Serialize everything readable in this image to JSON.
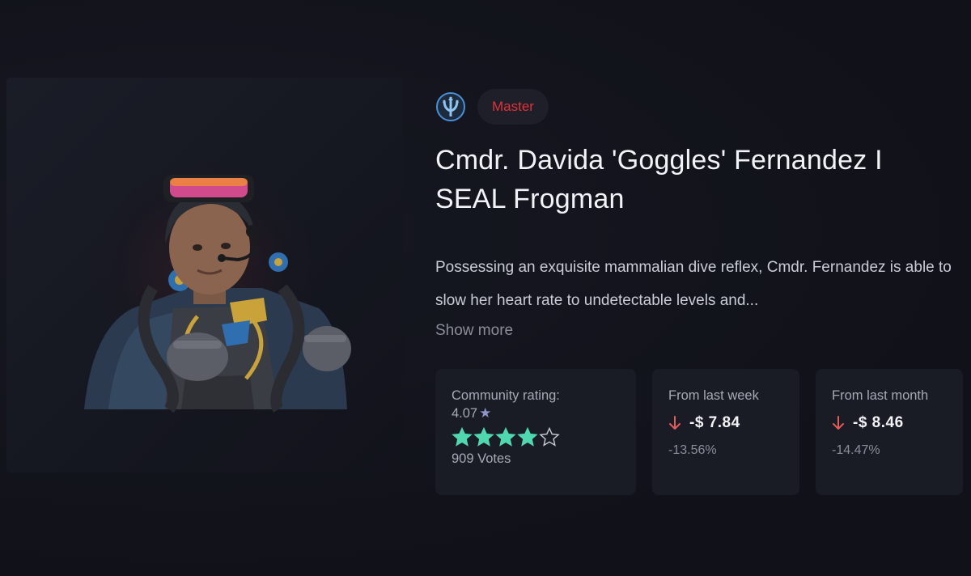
{
  "item": {
    "rarity": "Master",
    "title": "Cmdr. Davida 'Goggles' Fernandez I SEAL Frogman",
    "description": "Possessing an exquisite mammalian dive reflex, Cmdr. Fernandez is able to slow her heart rate to undetectable levels and...",
    "show_more_label": "Show more",
    "image_icon": "operator-portrait-image",
    "faction_icon": "trident-emblem-icon"
  },
  "rating": {
    "label": "Community rating:",
    "value": "4.07",
    "star_glyph": "★",
    "stars_value": 4.07,
    "stars_max": 5,
    "votes": "909 Votes"
  },
  "week": {
    "label": "From last week",
    "amount": "-$ 7.84",
    "percent": "-13.56%",
    "direction_icon": "arrow-down-icon"
  },
  "month": {
    "label": "From last month",
    "amount": "-$ 8.46",
    "percent": "-14.47%",
    "direction_icon": "arrow-down-icon"
  },
  "colors": {
    "background": "#12131c",
    "card": "#1a1c25",
    "rarity_text": "#e0323a",
    "star": "#4fd8b0",
    "down_arrow": "#e55a5a"
  }
}
